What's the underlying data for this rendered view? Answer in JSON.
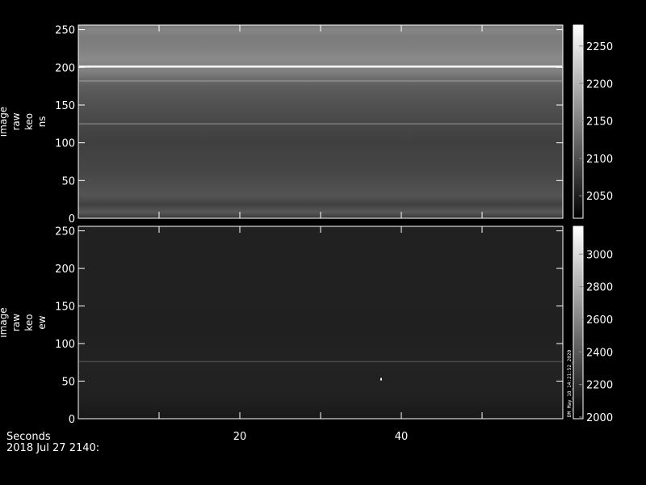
{
  "chart_data": [
    {
      "type": "heatmap",
      "ylabel_lines": [
        "image",
        "raw",
        "keo",
        "ns"
      ],
      "y_ticks": [
        0,
        50,
        100,
        150,
        200,
        250
      ],
      "ylim": [
        0,
        256
      ],
      "xlim": [
        0,
        60
      ],
      "x_ticks": [
        20,
        40
      ],
      "colorbar_ticks": [
        2050,
        2100,
        2150,
        2200,
        2250
      ],
      "colorbar_range": [
        2020,
        2278
      ],
      "colormap": "grayscale",
      "row_profile": [
        {
          "y": 0,
          "value": 2075
        },
        {
          "y": 8,
          "value": 2110
        },
        {
          "y": 18,
          "value": 2085
        },
        {
          "y": 30,
          "value": 2105
        },
        {
          "y": 45,
          "value": 2098
        },
        {
          "y": 60,
          "value": 2092
        },
        {
          "y": 80,
          "value": 2088
        },
        {
          "y": 100,
          "value": 2084
        },
        {
          "y": 125,
          "value": 2092
        },
        {
          "y": 145,
          "value": 2100
        },
        {
          "y": 160,
          "value": 2106
        },
        {
          "y": 175,
          "value": 2115
        },
        {
          "y": 185,
          "value": 2130
        },
        {
          "y": 195,
          "value": 2150
        },
        {
          "y": 210,
          "value": 2160
        },
        {
          "y": 225,
          "value": 2150
        },
        {
          "y": 240,
          "value": 2145
        },
        {
          "y": 250,
          "value": 2155
        },
        {
          "y": 256,
          "value": 2140
        }
      ],
      "bright_lines": [
        {
          "y": 201,
          "value": 2270
        },
        {
          "y": 182,
          "value": 2165
        },
        {
          "y": 125,
          "value": 2145
        }
      ]
    },
    {
      "type": "heatmap",
      "ylabel_lines": [
        "image",
        "raw",
        "keo",
        "ew"
      ],
      "y_ticks": [
        0,
        50,
        100,
        150,
        200,
        250
      ],
      "ylim": [
        0,
        256
      ],
      "xlim": [
        0,
        60
      ],
      "x_ticks": [
        20,
        40
      ],
      "colorbar_ticks": [
        2000,
        2200,
        2400,
        2600,
        2800,
        3000
      ],
      "colorbar_range": [
        1990,
        3170
      ],
      "colormap": "grayscale",
      "row_profile": [
        {
          "y": 0,
          "value": 2100
        },
        {
          "y": 30,
          "value": 2145
        },
        {
          "y": 70,
          "value": 2150
        },
        {
          "y": 120,
          "value": 2140
        },
        {
          "y": 160,
          "value": 2145
        },
        {
          "y": 200,
          "value": 2142
        },
        {
          "y": 256,
          "value": 2145
        }
      ],
      "bright_lines": [
        {
          "y": 76,
          "value": 2330
        }
      ],
      "hot_pixels": [
        {
          "x": 37.5,
          "y": 52,
          "value": 3170
        }
      ],
      "stamp": "DM_May_18_14:21:52_2020"
    }
  ],
  "footer": {
    "x_axis_label": "Seconds",
    "date_label": "2018 Jul 27 2140:"
  }
}
